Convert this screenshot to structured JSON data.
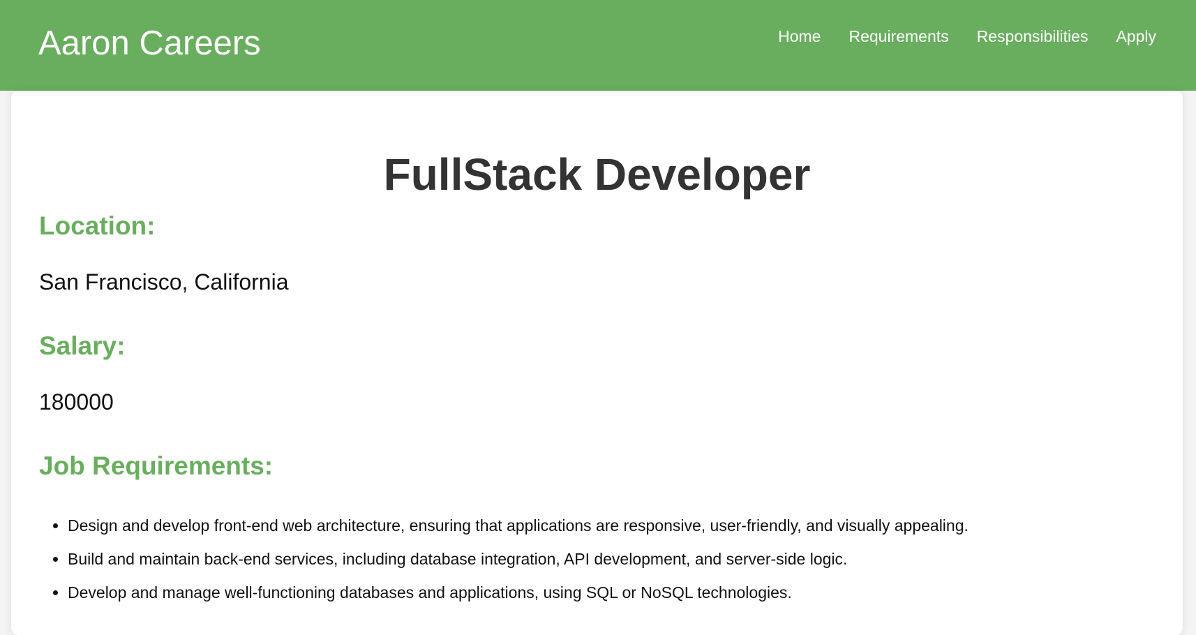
{
  "header": {
    "brand": "Aaron Careers",
    "nav": [
      {
        "label": "Home"
      },
      {
        "label": "Requirements"
      },
      {
        "label": "Responsibilities"
      },
      {
        "label": "Apply"
      }
    ]
  },
  "job": {
    "title": "FullStack Developer",
    "location_heading": "Location:",
    "location": "San Francisco, California",
    "salary_heading": "Salary:",
    "salary": "180000",
    "requirements_heading": "Job Requirements:",
    "requirements": [
      "Design and develop front-end web architecture, ensuring that applications are responsive, user-friendly, and visually appealing.",
      "Build and maintain back-end services, including database integration, API development, and server-side logic.",
      "Develop and manage well-functioning databases and applications, using SQL or NoSQL technologies."
    ]
  },
  "colors": {
    "header_bg": "#69ae5e",
    "heading_green": "#69ae5e",
    "title_text": "#333333"
  }
}
